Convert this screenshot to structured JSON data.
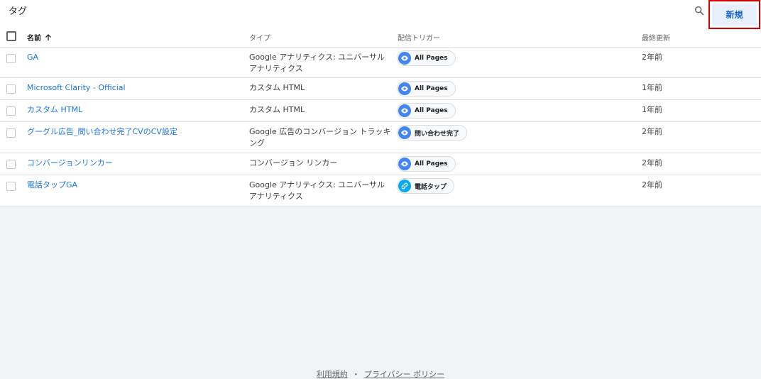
{
  "panel": {
    "title": "タグ",
    "new_button_label": "新規"
  },
  "columns": {
    "name": "名前",
    "type": "タイプ",
    "trigger": "配信トリガー",
    "updated": "最終更新"
  },
  "rows": [
    {
      "name": "GA",
      "type": "Google アナリティクス: ユニバーサル アナリティクス",
      "trigger": "All Pages",
      "trigger_icon": "eye-icon",
      "updated": "2年前"
    },
    {
      "name": "Microsoft Clarity - Official",
      "type": "カスタム HTML",
      "trigger": "All Pages",
      "trigger_icon": "eye-icon",
      "updated": "1年前"
    },
    {
      "name": "カスタム HTML",
      "type": "カスタム HTML",
      "trigger": "All Pages",
      "trigger_icon": "eye-icon",
      "updated": "1年前"
    },
    {
      "name": "グーグル広告_問い合わせ完了CVのCV設定",
      "type": "Google 広告のコンバージョン トラッキング",
      "trigger": "問い合わせ完了",
      "trigger_icon": "eye-icon",
      "updated": "2年前"
    },
    {
      "name": "コンバージョンリンカー",
      "type": "コンバージョン リンカー",
      "trigger": "All Pages",
      "trigger_icon": "eye-icon",
      "updated": "2年前"
    },
    {
      "name": "電話タップGA",
      "type": "Google アナリティクス: ユニバーサル アナリティクス",
      "trigger": "電話タップ",
      "trigger_icon": "link-icon",
      "updated": "2年前"
    }
  ],
  "footer": {
    "terms": "利用規約",
    "separator": "・",
    "privacy": "プライバシー ポリシー"
  },
  "colors": {
    "accent": "#1a73e8",
    "highlight_border": "#d50000",
    "chip_eye": "#4285f4",
    "chip_link": "#03a9f4"
  }
}
